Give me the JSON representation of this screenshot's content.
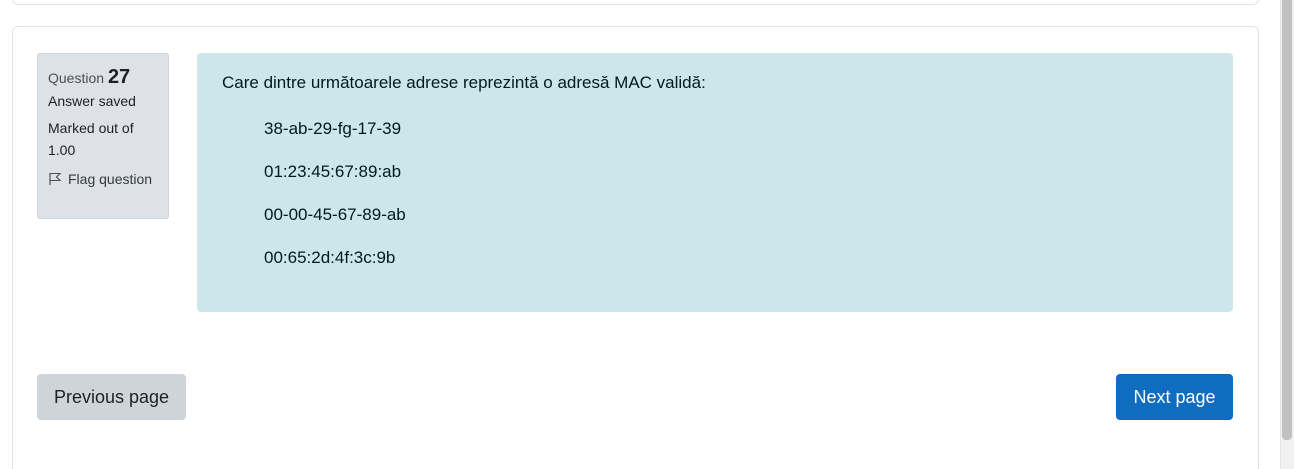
{
  "question_info": {
    "label": "Question",
    "number": "27",
    "state": "Answer saved",
    "grade_line1": "Marked out of",
    "grade_line2": "1.00",
    "flag_label": "Flag question"
  },
  "question": {
    "text": "Care dintre următoarele adrese reprezintă o adresă MAC validă:",
    "answers": [
      "38-ab-29-fg-17-39",
      "01:23:45:67:89:ab",
      "00-00-45-67-89-ab",
      "00:65:2d:4f:3c:9b"
    ]
  },
  "navigation": {
    "previous_label": "Previous page",
    "next_label": "Next page"
  },
  "colors": {
    "info_bg": "#dee2e6",
    "formulation_bg": "#cce6ea",
    "next_button_bg": "#0f6cbf",
    "prev_button_bg": "#ced4da"
  },
  "icons": {
    "flag": "flag-icon"
  }
}
